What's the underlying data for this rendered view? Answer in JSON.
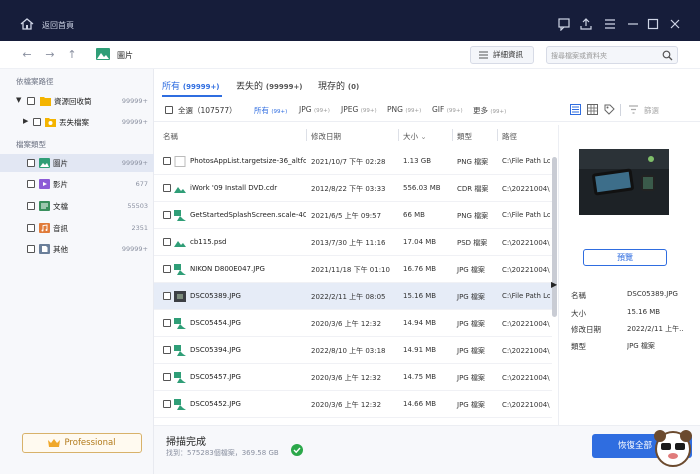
{
  "titlebar": {
    "title": "返回首頁",
    "home_icon": "home-icon",
    "controls": [
      "feedback-icon",
      "upload-icon",
      "menu-icon",
      "minimize-icon",
      "maximize-icon",
      "close-icon"
    ]
  },
  "nav": {
    "breadcrumb": "圖片",
    "detail_label": "詳細資訊",
    "search_placeholder": "搜尋檔案或資料夾"
  },
  "sidebar": {
    "location_title": "依檔案路徑",
    "tree": [
      {
        "label": "資源回收筒",
        "count": "99999+",
        "arrow": "▼"
      },
      {
        "label": "丟失檔案",
        "count": "99999+",
        "arrow": "▶"
      }
    ],
    "type_title": "檔案類型",
    "types": [
      {
        "label": "圖片",
        "count": "99999+",
        "color": "#2f9e77"
      },
      {
        "label": "影片",
        "count": "677",
        "color": "#8c5bd6"
      },
      {
        "label": "文檔",
        "count": "55503",
        "color": "#3a8f5d"
      },
      {
        "label": "音訊",
        "count": "2351",
        "color": "#e07b3a"
      },
      {
        "label": "其他",
        "count": "99999+",
        "color": "#6b7f9a"
      }
    ],
    "pro_label": "Professional"
  },
  "filter_tabs": [
    {
      "label": "所有",
      "count": "(99999+)"
    },
    {
      "label": "丟失的",
      "count": "(99999+)"
    },
    {
      "label": "現存的",
      "count": "(0)"
    }
  ],
  "toolbar": {
    "all_label": "全選",
    "all_count": "（107577）",
    "types": [
      {
        "label": "所有",
        "count": "(99+)"
      },
      {
        "label": "JPG",
        "count": "(99+)"
      },
      {
        "label": "JPEG",
        "count": "(99+)"
      },
      {
        "label": "PNG",
        "count": "(99+)"
      },
      {
        "label": "GIF",
        "count": "(99+)"
      },
      {
        "label": "更多",
        "count": "(99+)"
      }
    ],
    "sort_label": "篩選"
  },
  "table": {
    "headers": {
      "name": "名稱",
      "date": "修改日期",
      "size": "大小",
      "type": "類型",
      "path": "路徑"
    },
    "rows": [
      {
        "name": "PhotosAppList.targetsize-36_altfo...",
        "date": "2021/10/7 下午 02:28",
        "size": "1.13 GB",
        "type": "PNG 檔案",
        "path": "C:\\File Path Lost"
      },
      {
        "name": "iWork '09 Install DVD.cdr",
        "date": "2012/8/22 下午 03:33",
        "size": "556.03 MB",
        "type": "CDR 檔案",
        "path": "C:\\20221004\\新"
      },
      {
        "name": "GetStartedSplashScreen.scale-40...",
        "date": "2021/6/5 上午 09:57",
        "size": "66 MB",
        "type": "PNG 檔案",
        "path": "C:\\File Path Lost"
      },
      {
        "name": "cb115.psd",
        "date": "2013/7/30 上午 11:16",
        "size": "17.04 MB",
        "type": "PSD 檔案",
        "path": "C:\\20221004\\新"
      },
      {
        "name": "NIKON D800E047.JPG",
        "date": "2021/11/18 下午 01:10",
        "size": "16.76 MB",
        "type": "JPG 檔案",
        "path": "C:\\20221004\\新"
      },
      {
        "name": "DSC05389.JPG",
        "date": "2022/2/11 上午 08:05",
        "size": "15.16 MB",
        "type": "JPG 檔案",
        "path": "C:\\File Path Lost"
      },
      {
        "name": "DSC05454.JPG",
        "date": "2020/3/6 上午 12:32",
        "size": "14.94 MB",
        "type": "JPG 檔案",
        "path": "C:\\20221004\\新"
      },
      {
        "name": "DSC05394.JPG",
        "date": "2022/8/10 上午 03:18",
        "size": "14.91 MB",
        "type": "JPG 檔案",
        "path": "C:\\20221004\\新"
      },
      {
        "name": "DSC05457.JPG",
        "date": "2020/3/6 上午 12:32",
        "size": "14.75 MB",
        "type": "JPG 檔案",
        "path": "C:\\20221004\\新"
      },
      {
        "name": "DSC05452.JPG",
        "date": "2020/3/6 上午 12:32",
        "size": "14.66 MB",
        "type": "JPG 檔案",
        "path": "C:\\20221004\\新"
      }
    ]
  },
  "details": {
    "preview_label": "預覽",
    "props": [
      {
        "label": "名稱",
        "value": "DSC05389.JPG"
      },
      {
        "label": "大小",
        "value": "15.16 MB"
      },
      {
        "label": "修改日期",
        "value": "2022/2/11 上午..."
      },
      {
        "label": "類型",
        "value": "JPG 檔案"
      }
    ]
  },
  "status": {
    "title": "掃描完成",
    "subtitle": "找到：575283個檔案，369.58 GB",
    "recover_label": "恢復全部"
  },
  "colors": {
    "accent": "#2f6de0",
    "titlebar": "#161d3a",
    "success": "#2ba84a",
    "pro": "#d8b26a"
  }
}
